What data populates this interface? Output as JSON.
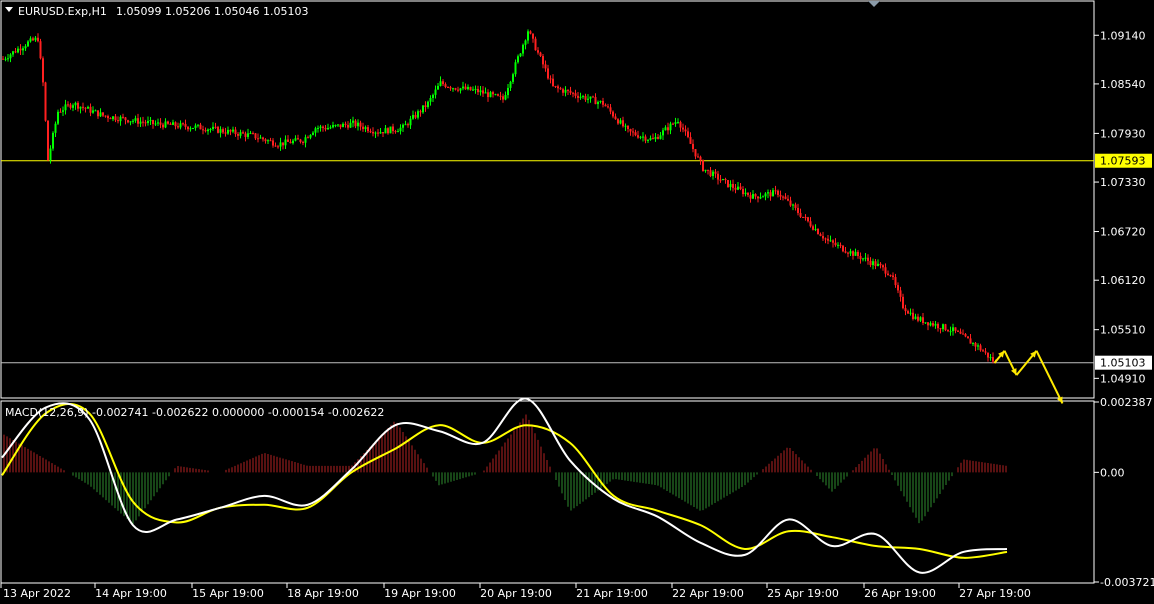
{
  "header": {
    "symbol": "EURUSD.Exp,H1",
    "ohlc": "1.05099 1.05206 1.05046 1.05103"
  },
  "macd_header": "MACD(12,26,9) -0.002741 -0.002622 0.000000 -0.000154 -0.002622",
  "colors": {
    "background": "#000000",
    "bull": "#00ff00",
    "bear": "#ff2020",
    "level_line": "#ffff00",
    "signal": "#ffff00",
    "macd_line": "#ffffff",
    "hist_pos": "#b22222",
    "hist_neg": "#2e8b2e",
    "arrows": "#ffea00"
  },
  "price_axis": {
    "ticks": [
      "1.09140",
      "1.08540",
      "1.07930",
      "1.07330",
      "1.06720",
      "1.06120",
      "1.05510",
      "1.04910"
    ],
    "current_label": "1.05103",
    "level_label": "1.07593"
  },
  "macd_axis": {
    "ticks": [
      "0.002387",
      "0.00",
      "-0.003721"
    ]
  },
  "time_axis": {
    "labels": [
      "13 Apr 2022",
      "14 Apr 19:00",
      "15 Apr 19:00",
      "18 Apr 19:00",
      "19 Apr 19:00",
      "20 Apr 19:00",
      "21 Apr 19:00",
      "22 Apr 19:00",
      "25 Apr 19:00",
      "26 Apr 19:00",
      "27 Apr 19:00"
    ]
  },
  "chart_data": [
    {
      "type": "candlestick",
      "symbol": "EURUSD.Exp",
      "timeframe": "H1",
      "ylim": [
        1.0468,
        1.0955
      ],
      "horizontal_levels": [
        1.07593,
        1.05103
      ],
      "path_keypoints": {
        "x_index": [
          0,
          10,
          14,
          16,
          18,
          22,
          28,
          40,
          60,
          80,
          100,
          110,
          120,
          125,
          130,
          140,
          150,
          160,
          165,
          170,
          175,
          180,
          190,
          200,
          210,
          220,
          230,
          240,
          250,
          260,
          270,
          280,
          290,
          300,
          310,
          320,
          330,
          340,
          350,
          355,
          360,
          365,
          370,
          375,
          380,
          390,
          397
        ],
        "close": [
          1.0885,
          1.0905,
          1.091,
          1.0855,
          1.076,
          1.082,
          1.083,
          1.0815,
          1.0805,
          1.08,
          1.079,
          1.078,
          1.0785,
          1.08,
          1.08,
          1.0805,
          1.0795,
          1.08,
          1.0815,
          1.083,
          1.0855,
          1.085,
          1.0845,
          1.0835,
          1.092,
          1.085,
          1.084,
          1.083,
          1.0795,
          1.0785,
          1.081,
          1.075,
          1.073,
          1.0715,
          1.072,
          1.069,
          1.066,
          1.0645,
          1.063,
          1.062,
          1.058,
          1.0565,
          1.056,
          1.0555,
          1.055,
          1.053,
          1.051
        ]
      },
      "forecast_arrows": [
        [
          1.051,
          1.0525
        ],
        [
          1.0525,
          1.0495
        ],
        [
          1.0495,
          1.0525
        ],
        [
          1.0525,
          1.046
        ]
      ]
    },
    {
      "type": "line",
      "indicator": "MACD(12,26,9)",
      "series": [
        {
          "name": "macd",
          "values": [
            0.0005,
            0.0022,
            0.0018,
            -0.0018,
            -0.0016,
            -0.0012,
            -0.0008,
            -0.0011,
            0.0001,
            0.0016,
            0.0014,
            0.001,
            0.0025,
            0.0004,
            -0.0009,
            -0.0015,
            -0.0024,
            -0.0028,
            -0.0016,
            -0.0025,
            -0.0021,
            -0.0034,
            -0.0027,
            -0.0026
          ]
        },
        {
          "name": "signal",
          "values": [
            -0.0001,
            0.002,
            0.002,
            -0.001,
            -0.0017,
            -0.0012,
            -0.0011,
            -0.0012,
            0.0,
            0.0008,
            0.0016,
            0.001,
            0.0016,
            0.001,
            -0.0008,
            -0.0013,
            -0.0018,
            -0.0026,
            -0.002,
            -0.0022,
            -0.0025,
            -0.0026,
            -0.0029,
            -0.0027
          ]
        }
      ],
      "ylim": [
        -0.003721,
        0.002387
      ]
    }
  ]
}
